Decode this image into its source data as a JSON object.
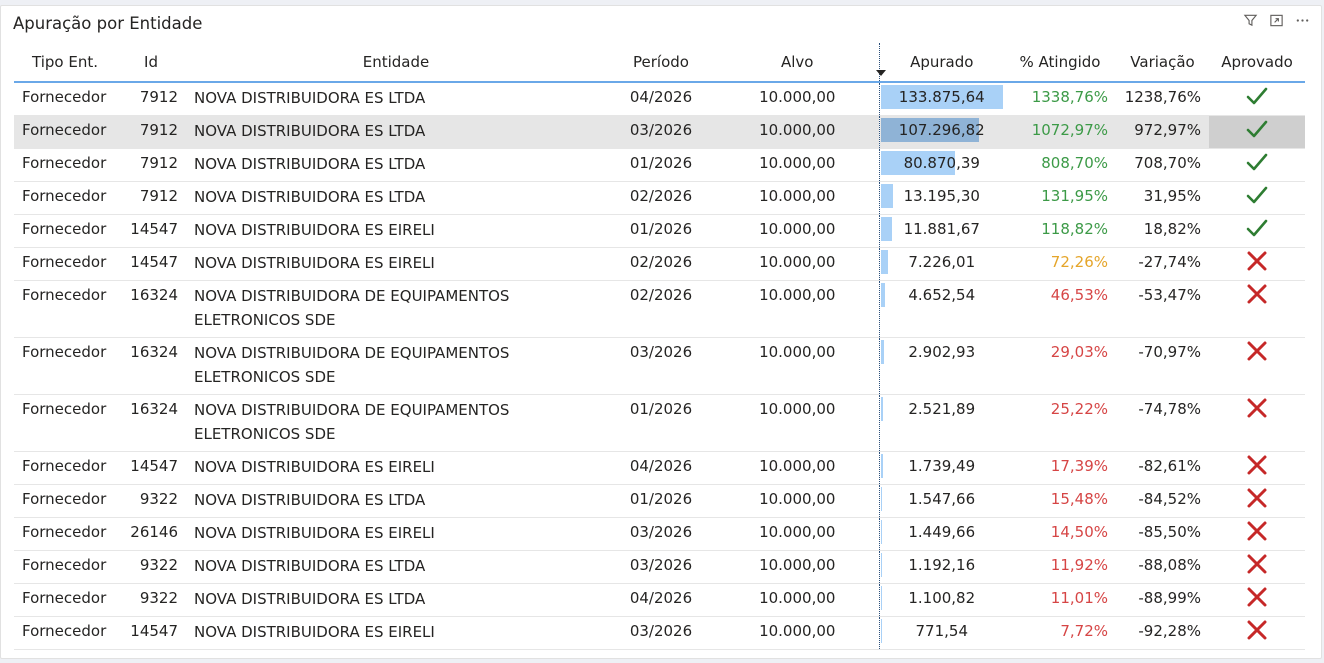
{
  "header": {
    "title": "Apuração por Entidade",
    "icons": [
      "filter-icon",
      "expand-icon",
      "more-options-icon"
    ]
  },
  "columns": [
    "Tipo Ent.",
    "Id",
    "Entidade",
    "Período",
    "Alvo",
    "Apurado",
    "% Atingido",
    "Variação",
    "Aprovado"
  ],
  "colors": {
    "bar": "#a9d1f7",
    "green": "#3c9a47",
    "orange": "#e5a52a",
    "red": "#d64545",
    "accent": "#6aa8e8"
  },
  "rows": [
    {
      "tipo": "Fornecedor",
      "id": "7912",
      "entidade": "NOVA DISTRIBUIDORA ES LTDA",
      "periodo": "04/2026",
      "alvo": "10.000,00",
      "apurado": "133.875,64",
      "apurado_value": 133875.64,
      "atingido": "1338,76%",
      "status": "green",
      "variacao": "1238,76%",
      "aprovado": true
    },
    {
      "tipo": "Fornecedor",
      "id": "7912",
      "entidade": "NOVA DISTRIBUIDORA ES LTDA",
      "periodo": "03/2026",
      "alvo": "10.000,00",
      "apurado": "107.296,82",
      "apurado_value": 107296.82,
      "atingido": "1072,97%",
      "status": "green",
      "variacao": "972,97%",
      "aprovado": true,
      "selected": true
    },
    {
      "tipo": "Fornecedor",
      "id": "7912",
      "entidade": "NOVA DISTRIBUIDORA ES LTDA",
      "periodo": "01/2026",
      "alvo": "10.000,00",
      "apurado": "80.870,39",
      "apurado_value": 80870.39,
      "atingido": "808,70%",
      "status": "green",
      "variacao": "708,70%",
      "aprovado": true
    },
    {
      "tipo": "Fornecedor",
      "id": "7912",
      "entidade": "NOVA DISTRIBUIDORA ES LTDA",
      "periodo": "02/2026",
      "alvo": "10.000,00",
      "apurado": "13.195,30",
      "apurado_value": 13195.3,
      "atingido": "131,95%",
      "status": "green",
      "variacao": "31,95%",
      "aprovado": true
    },
    {
      "tipo": "Fornecedor",
      "id": "14547",
      "entidade": "NOVA DISTRIBUIDORA ES EIRELI",
      "periodo": "01/2026",
      "alvo": "10.000,00",
      "apurado": "11.881,67",
      "apurado_value": 11881.67,
      "atingido": "118,82%",
      "status": "green",
      "variacao": "18,82%",
      "aprovado": true
    },
    {
      "tipo": "Fornecedor",
      "id": "14547",
      "entidade": "NOVA DISTRIBUIDORA ES EIRELI",
      "periodo": "02/2026",
      "alvo": "10.000,00",
      "apurado": "7.226,01",
      "apurado_value": 7226.01,
      "atingido": "72,26%",
      "status": "orange",
      "variacao": "-27,74%",
      "aprovado": false
    },
    {
      "tipo": "Fornecedor",
      "id": "16324",
      "entidade": "NOVA DISTRIBUIDORA DE EQUIPAMENTOS ELETRONICOS SDE",
      "periodo": "02/2026",
      "alvo": "10.000,00",
      "apurado": "4.652,54",
      "apurado_value": 4652.54,
      "atingido": "46,53%",
      "status": "red",
      "variacao": "-53,47%",
      "aprovado": false,
      "tall": true
    },
    {
      "tipo": "Fornecedor",
      "id": "16324",
      "entidade": "NOVA DISTRIBUIDORA DE EQUIPAMENTOS ELETRONICOS SDE",
      "periodo": "03/2026",
      "alvo": "10.000,00",
      "apurado": "2.902,93",
      "apurado_value": 2902.93,
      "atingido": "29,03%",
      "status": "red",
      "variacao": "-70,97%",
      "aprovado": false,
      "tall": true
    },
    {
      "tipo": "Fornecedor",
      "id": "16324",
      "entidade": "NOVA DISTRIBUIDORA DE EQUIPAMENTOS ELETRONICOS SDE",
      "periodo": "01/2026",
      "alvo": "10.000,00",
      "apurado": "2.521,89",
      "apurado_value": 2521.89,
      "atingido": "25,22%",
      "status": "red",
      "variacao": "-74,78%",
      "aprovado": false,
      "tall": true
    },
    {
      "tipo": "Fornecedor",
      "id": "14547",
      "entidade": "NOVA DISTRIBUIDORA ES EIRELI",
      "periodo": "04/2026",
      "alvo": "10.000,00",
      "apurado": "1.739,49",
      "apurado_value": 1739.49,
      "atingido": "17,39%",
      "status": "red",
      "variacao": "-82,61%",
      "aprovado": false
    },
    {
      "tipo": "Fornecedor",
      "id": "9322",
      "entidade": "NOVA DISTRIBUIDORA ES LTDA",
      "periodo": "01/2026",
      "alvo": "10.000,00",
      "apurado": "1.547,66",
      "apurado_value": 1547.66,
      "atingido": "15,48%",
      "status": "red",
      "variacao": "-84,52%",
      "aprovado": false
    },
    {
      "tipo": "Fornecedor",
      "id": "26146",
      "entidade": "NOVA DISTRIBUIDORA ES EIRELI",
      "periodo": "03/2026",
      "alvo": "10.000,00",
      "apurado": "1.449,66",
      "apurado_value": 1449.66,
      "atingido": "14,50%",
      "status": "red",
      "variacao": "-85,50%",
      "aprovado": false
    },
    {
      "tipo": "Fornecedor",
      "id": "9322",
      "entidade": "NOVA DISTRIBUIDORA ES LTDA",
      "periodo": "03/2026",
      "alvo": "10.000,00",
      "apurado": "1.192,16",
      "apurado_value": 1192.16,
      "atingido": "11,92%",
      "status": "red",
      "variacao": "-88,08%",
      "aprovado": false
    },
    {
      "tipo": "Fornecedor",
      "id": "9322",
      "entidade": "NOVA DISTRIBUIDORA ES LTDA",
      "periodo": "04/2026",
      "alvo": "10.000,00",
      "apurado": "1.100,82",
      "apurado_value": 1100.82,
      "atingido": "11,01%",
      "status": "red",
      "variacao": "-88,99%",
      "aprovado": false
    },
    {
      "tipo": "Fornecedor",
      "id": "14547",
      "entidade": "NOVA DISTRIBUIDORA ES EIRELI",
      "periodo": "03/2026",
      "alvo": "10.000,00",
      "apurado": "771,54",
      "apurado_value": 771.54,
      "atingido": "7,72%",
      "status": "red",
      "variacao": "-92,28%",
      "aprovado": false
    }
  ]
}
